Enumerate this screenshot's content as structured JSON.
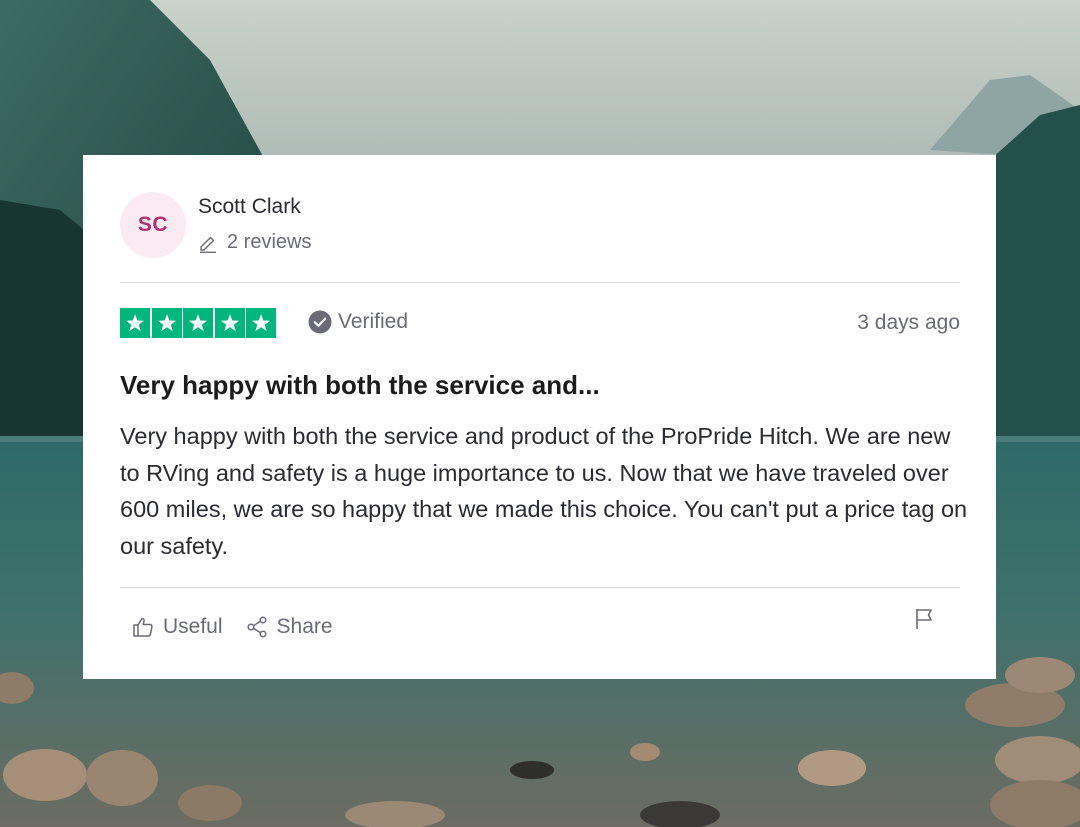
{
  "review": {
    "author_initials": "SC",
    "author_name": "Scott Clark",
    "review_count": "2 reviews",
    "rating": 5,
    "rating_max": 5,
    "verified_label": "Verified",
    "date": "3 days ago",
    "title": "Very happy with both the service and...",
    "body": "Very happy with both the service and product of the ProPride Hitch. We are new to RVing and safety is a huge importance to us. Now that we have traveled over 600 miles, we are so happy that we made this choice. You can't put a price tag on our safety.",
    "actions": {
      "useful_label": "Useful",
      "share_label": "Share"
    }
  },
  "colors": {
    "star_green": "#00b67a",
    "avatar_bg": "#fbeaf2",
    "avatar_text": "#b1306f",
    "muted_text": "#6b6b78"
  },
  "icons": [
    "pencil-icon",
    "star-icon",
    "verified-check-icon",
    "thumbs-up-icon",
    "share-icon",
    "flag-icon"
  ]
}
